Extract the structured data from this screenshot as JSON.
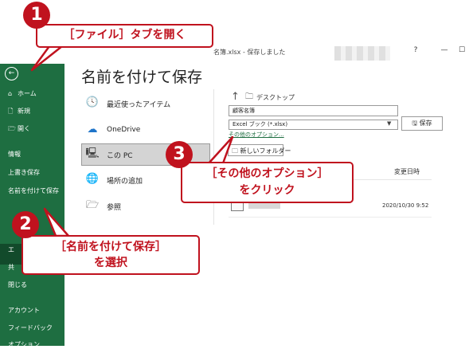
{
  "window": {
    "title": "名簿.xlsx - 保存しました",
    "help": "?",
    "minimize": "—",
    "maximize": "☐"
  },
  "sidebar": {
    "back": "←",
    "items": [
      {
        "label": "ホーム",
        "icon": "⌂"
      },
      {
        "label": "新規",
        "icon": "🗋"
      },
      {
        "label": "開く",
        "icon": "🗁"
      },
      {
        "label": "情報",
        "icon": ""
      },
      {
        "label": "上書き保存",
        "icon": ""
      },
      {
        "label": "名前を付けて保存",
        "icon": ""
      },
      {
        "label": "エ",
        "icon": ""
      },
      {
        "label": "共",
        "icon": ""
      },
      {
        "label": "閉じる",
        "icon": ""
      },
      {
        "label": "アカウント",
        "icon": ""
      },
      {
        "label": "フィードバック",
        "icon": ""
      },
      {
        "label": "オプション",
        "icon": ""
      }
    ]
  },
  "main": {
    "title": "名前を付けて保存",
    "places": [
      {
        "label": "最近使ったアイテム",
        "icon": "🕓"
      },
      {
        "label": "OneDrive",
        "icon": "☁"
      },
      {
        "label": "この PC",
        "icon": "🖳"
      },
      {
        "label": "場所の追加",
        "icon": "🌐"
      },
      {
        "label": "参照",
        "icon": "🗁"
      }
    ],
    "path": "デスクトップ",
    "filename": "顧客名簿",
    "filetype": "Excel ブック (*.xlsx)",
    "more_options": "その他のオプション...",
    "save": "保存",
    "new_folder": "新しいフォルダー",
    "col_modified": "変更日時",
    "file_date": "2020/10/30 9:52"
  },
  "callouts": {
    "c1": {
      "num": "1",
      "text": "［ファイル］タブを開く"
    },
    "c2": {
      "num": "2",
      "line1": "［名前を付けて保存］",
      "line2": "を選択"
    },
    "c3": {
      "num": "3",
      "line1": "［その他のオプション］",
      "line2": "をクリック"
    }
  },
  "colors": {
    "sidebar": "#1e6e41",
    "accent": "#c0121e"
  }
}
